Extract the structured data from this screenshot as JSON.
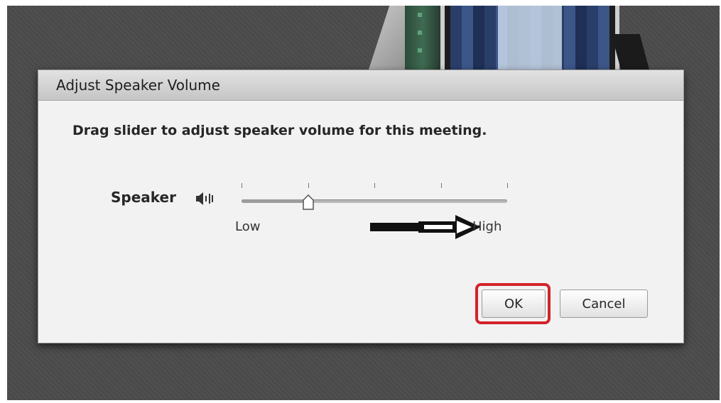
{
  "dialog": {
    "title": "Adjust Speaker Volume",
    "instruction": "Drag slider to adjust speaker volume for this meeting."
  },
  "speaker": {
    "label": "Speaker",
    "icon": "speaker-volume-icon",
    "slider": {
      "value_fraction": 0.25,
      "tick_count": 5,
      "low_label": "Low",
      "high_label": "High"
    }
  },
  "buttons": {
    "ok_label": "OK",
    "cancel_label": "Cancel"
  },
  "annotations": {
    "arrow": "arrow-right-icon",
    "highlight_color": "#d2232a"
  }
}
